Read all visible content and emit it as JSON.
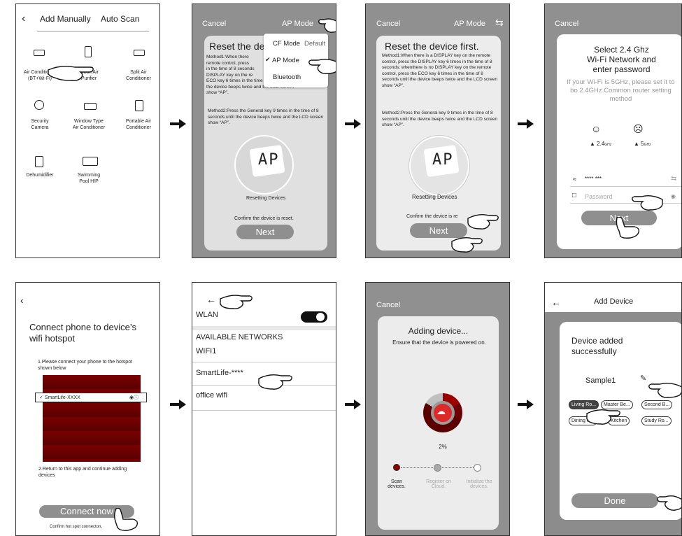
{
  "p1": {
    "tab_manual": "Add Manually",
    "tab_scan": "Auto Scan",
    "devices": [
      {
        "label": "Air Conditioner\n(BT+Wi-Fi)",
        "icon": "air-conditioner-icon"
      },
      {
        "label": "Fresh Air\nPurifier",
        "icon": "purifier-icon"
      },
      {
        "label": "Split Air\nConditioner",
        "icon": "split-ac-icon"
      },
      {
        "label": "Security\nCamera",
        "icon": "camera-icon"
      },
      {
        "label": "Window Type\nAir Conditioner",
        "icon": "window-ac-icon"
      },
      {
        "label": "Portable Air\nConditioner",
        "icon": "portable-ac-icon"
      },
      {
        "label": "Dehumidifier",
        "icon": "dehumidifier-icon"
      },
      {
        "label": "Swimming\nPool H/P",
        "icon": "pool-hp-icon"
      }
    ]
  },
  "p2": {
    "cancel": "Cancel",
    "mode": "AP Mode",
    "title": "Reset the de",
    "menu": [
      "CF Mode",
      "AP Mode",
      "Bluetooth"
    ],
    "menu_default": "Default",
    "method1_a": "Method1:When there",
    "method1_b": "remote control, press",
    "method1_c": "in the time of 8 seconds",
    "method1_d": "DISPLAY key on the re",
    "method1_e": "ECO key 6 times in the time of 8 seconds until",
    "method1_f": "the device beeps twice and the LCD screen",
    "method1_g": "show “AP”.",
    "method2": "Method2:Press the General key 9 times in the time of 8 seconds until the device beeps twice and the LCD screen show “AP”.",
    "display": "AP",
    "resetting": "Resetting Devices",
    "confirm": "Confirm the device is reset.",
    "next": "Next"
  },
  "p3": {
    "cancel": "Cancel",
    "mode": "AP Mode",
    "title": "Reset the device first.",
    "method1": "Method1:When there is a DISPLAY key on the remote control, press the DISPLAY key 6 times in the time of 8 seconds; whenthere is no DISPLAY key on the remote control, press the ECO key 6 times in the time of 8 seconds until the device beeps twice and the LCD screen show “AP”.",
    "method2": "Method2:Press the General key 9 times in the time of 8 seconds until the device beeps twice and the LCD screen show “AP”.",
    "display": "AP",
    "resetting": "Resetting Devices",
    "confirm": "Confirm the device is re",
    "next": "Next"
  },
  "p4": {
    "cancel": "Cancel",
    "title": "Select 2.4 Ghz\nWi-Fi Network and\nenter password",
    "hint": "If your Wi-Fi is 5GHz, please set it to\nbo 2.4GHz.Common router setting\nmethod",
    "band1": "2.4",
    "band1_unit": "GHz",
    "band2": "5",
    "band2_unit": "GHz",
    "ssid": "**** ***",
    "password_placeholder": "Password",
    "next": "Next"
  },
  "p5": {
    "title": "Connect phone to device’s\nwifi hotspot",
    "step1": "1.Please connect your phone to the hotspot\nshown below",
    "hotspot": "SmartLife-XXXX",
    "step2": "2.Return to this app and continue adding\ndevices",
    "button": "Connect now",
    "footer": "Confirm hot spot connecton,"
  },
  "p6": {
    "wlan": "WLAN",
    "available": "AVAILABLE NETWORKS",
    "wifi1": "WIFI1",
    "smartlife": "SmartLife-****",
    "office": "office wifi"
  },
  "p7": {
    "cancel": "Cancel",
    "title": "Adding device...",
    "subtitle": "Ensure that the device is powered on.",
    "progress_value": 0.02,
    "progress_text": "2%",
    "step1": "Scan\ndevices.",
    "step2": "Register on\nCloud.",
    "step3": "Initialize the\ndevices."
  },
  "p8": {
    "title": "Add Device",
    "success": "Device added\nsuccessfully",
    "name": "Sample1",
    "rooms": [
      "Living Ro...",
      "Master Be...",
      "Second B...",
      "Dining R...",
      "Kitchen",
      "Study Ro..."
    ],
    "done": "Done"
  },
  "colors": {
    "panel_gray": "#909090",
    "card": "#ececec",
    "button": "#8f8f8f",
    "hotspot_red": "#7a0000",
    "progress_red": "#8b0000"
  }
}
